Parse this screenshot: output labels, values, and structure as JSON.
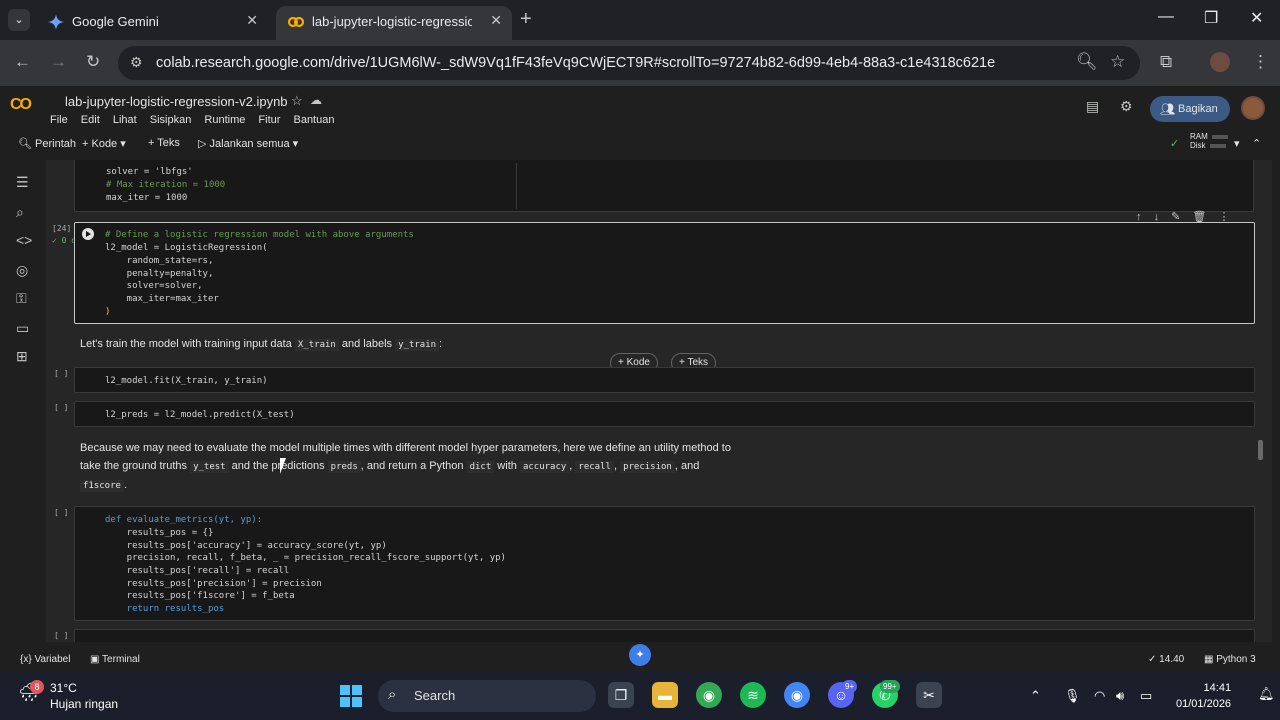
{
  "browser": {
    "tabs": [
      {
        "title": "Google Gemini",
        "active": false
      },
      {
        "title": "lab-jupyter-logistic-regressio",
        "active": true
      }
    ],
    "url": "colab.research.google.com/drive/1UGM6lW-_sdW9Vq1fF43feVq9CWjECT9R#scrollTo=97274b82-6d99-4eb4-88a3-c1e4318c621e"
  },
  "colab": {
    "notebook_title": "lab-jupyter-logistic-regression-v2.ipynb",
    "menu": [
      "File",
      "Edit",
      "Lihat",
      "Sisipkan",
      "Runtime",
      "Fitur",
      "Bantuan"
    ],
    "share_label": "Bagikan",
    "toolbar": {
      "command": "Perintah",
      "add_code": "Kode",
      "add_text": "Teks",
      "run_all": "Jalankan semua",
      "ram": "RAM",
      "disk": "Disk"
    },
    "add_buttons": {
      "code": "Kode",
      "text": "Teks"
    }
  },
  "cells": {
    "cell1_lines": [
      "solver = 'lbfgs'",
      "# Max iteration = 1000",
      "max_iter = 1000"
    ],
    "cell2": {
      "exec_count": "[24]",
      "status": "0 d",
      "lines": [
        "# Define a logistic regression model with above arguments",
        "l2_model = LogisticRegression(",
        "    random_state=rs,",
        "    penalty=penalty,",
        "    solver=solver,",
        "    max_iter=max_iter",
        ")"
      ]
    },
    "md1": {
      "text_a": "Let's train the model with training input data ",
      "code_a": "X_train",
      "text_b": " and labels ",
      "code_b": "y_train",
      "text_c": ":"
    },
    "cell3": {
      "exec_count": "[ ]",
      "line": "l2_model.fit(X_train, y_train)"
    },
    "cell4": {
      "exec_count": "[ ]",
      "line": "l2_preds = l2_model.predict(X_test)"
    },
    "md2": {
      "line1": "Because we may need to evaluate the model multiple times with different model hyper parameters, here we define an utility method to",
      "t1": "take the ground truths ",
      "c1": "y_test",
      "t2": " and the predictions ",
      "c2": "preds",
      "t3": ", and return a Python ",
      "c3": "dict",
      "t4": " with ",
      "c4": "accuracy",
      "t5": ", ",
      "c5": "recall",
      "t6": ", ",
      "c6": "precision",
      "t7": ", and",
      "c7": "f1score",
      "t8": "."
    },
    "cell5": {
      "exec_count": "[ ]",
      "lines": [
        "def evaluate_metrics(yt, yp):",
        "    results_pos = {}",
        "    results_pos['accuracy'] = accuracy_score(yt, yp)",
        "    precision, recall, f_beta, _ = precision_recall_fscore_support(yt, yp)",
        "    results_pos['recall'] = recall",
        "    results_pos['precision'] = precision",
        "    results_pos['f1score'] = f_beta",
        "    return results_pos"
      ]
    },
    "cell6": {
      "exec_count": "[ ]"
    }
  },
  "statusbar": {
    "variables": "Variabel",
    "terminal": "Terminal",
    "time": "14.40",
    "kernel": "Python 3"
  },
  "taskbar": {
    "weather_badge": "8",
    "temperature": "31°C",
    "condition": "Hujan ringan",
    "search": "Search",
    "badge_discord": "9+",
    "badge_whatsapp": "99+",
    "time": "14:41",
    "date": "01/01/2026"
  }
}
